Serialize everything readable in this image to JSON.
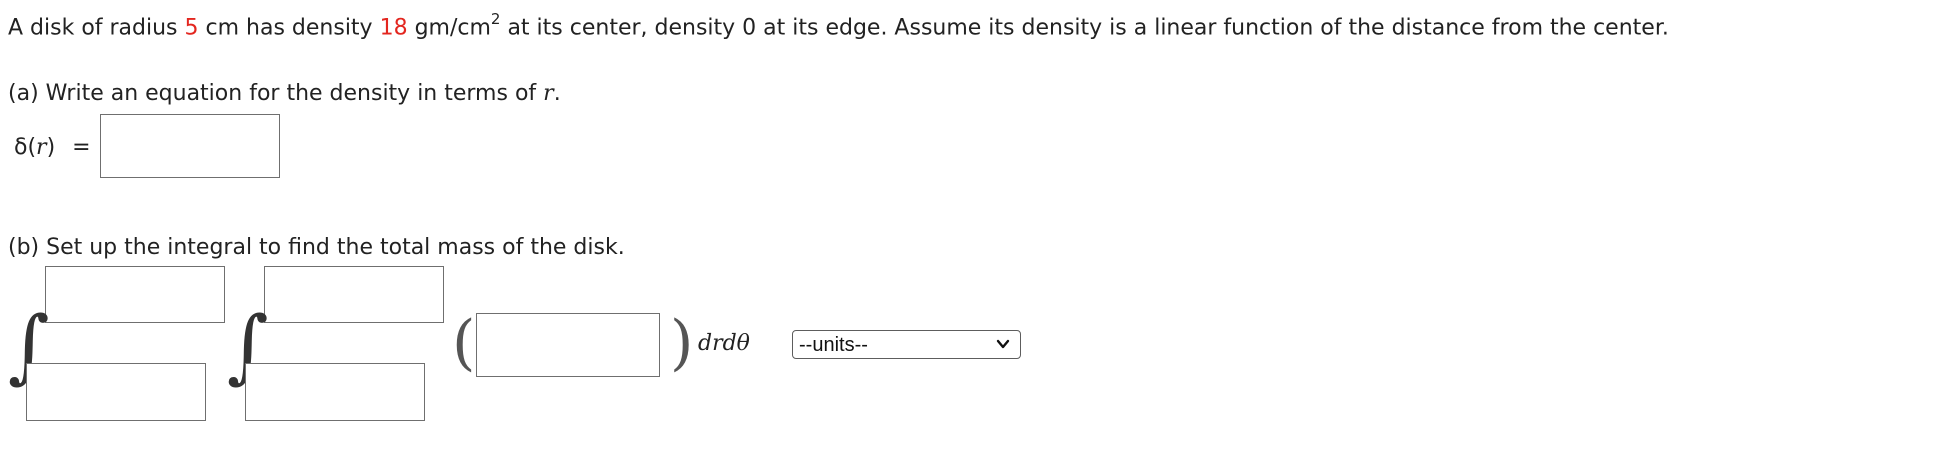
{
  "problem": {
    "part1": "A disk of radius ",
    "radius": "5",
    "part2": " cm has density ",
    "density": "18",
    "part3": " gm/cm",
    "exp": "2",
    "part4": " at its center, density 0 at its edge. Assume its density is a linear function of the distance from the center."
  },
  "part_a": {
    "prompt_prefix": "(a) Write an equation for the density in terms of ",
    "prompt_var": "r",
    "prompt_suffix": ".",
    "lhs_func": "δ(",
    "lhs_var": "r",
    "lhs_close": ")",
    "equals": "=",
    "answer_value": ""
  },
  "part_b": {
    "prompt": "(b) Set up the integral to find the total mass of the disk.",
    "integral_symbol": "∫",
    "outer_upper": "",
    "outer_lower": "",
    "inner_upper": "",
    "inner_lower": "",
    "integrand": "",
    "left_paren": "(",
    "right_paren": ")",
    "differentials": "drdθ",
    "units_selected": "--units--"
  },
  "colors": {
    "highlight": "#e3261f",
    "text": "#222222",
    "border": "#6f6f6f"
  }
}
